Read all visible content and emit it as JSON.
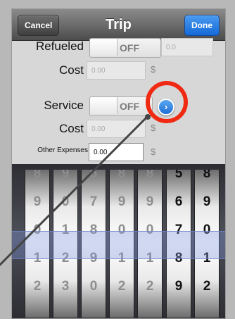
{
  "nav": {
    "cancel": "Cancel",
    "title": "Trip",
    "done": "Done"
  },
  "form": {
    "refueled": {
      "label": "Refueled",
      "toggle": "OFF",
      "value_placeholder": "0.0"
    },
    "refuel_cost": {
      "label": "Cost",
      "placeholder": "0.00",
      "currency": "$"
    },
    "service": {
      "label": "Service",
      "toggle": "OFF"
    },
    "service_cost": {
      "label": "Cost",
      "placeholder": "0.00",
      "currency": "$"
    },
    "other_expenses": {
      "label": "Other Expenses",
      "value": "0.00",
      "currency": "$"
    }
  },
  "picker": {
    "wheels": [
      [
        "8",
        "9",
        "0",
        "1",
        "2"
      ],
      [
        "9",
        "0",
        "1",
        "2",
        "3"
      ],
      [
        "6",
        "7",
        "8",
        "9",
        "0"
      ],
      [
        "8",
        "9",
        "0",
        "1",
        "2"
      ],
      [
        "8",
        "9",
        "0",
        "1",
        "2"
      ],
      [
        "5",
        "6",
        "7",
        "8",
        "9"
      ],
      [
        "8",
        "9",
        "0",
        "1",
        "2"
      ]
    ],
    "dark_wheels": [
      5,
      6
    ]
  },
  "colors": {
    "highlight": "#f02a12",
    "accent": "#1f6fd4"
  }
}
